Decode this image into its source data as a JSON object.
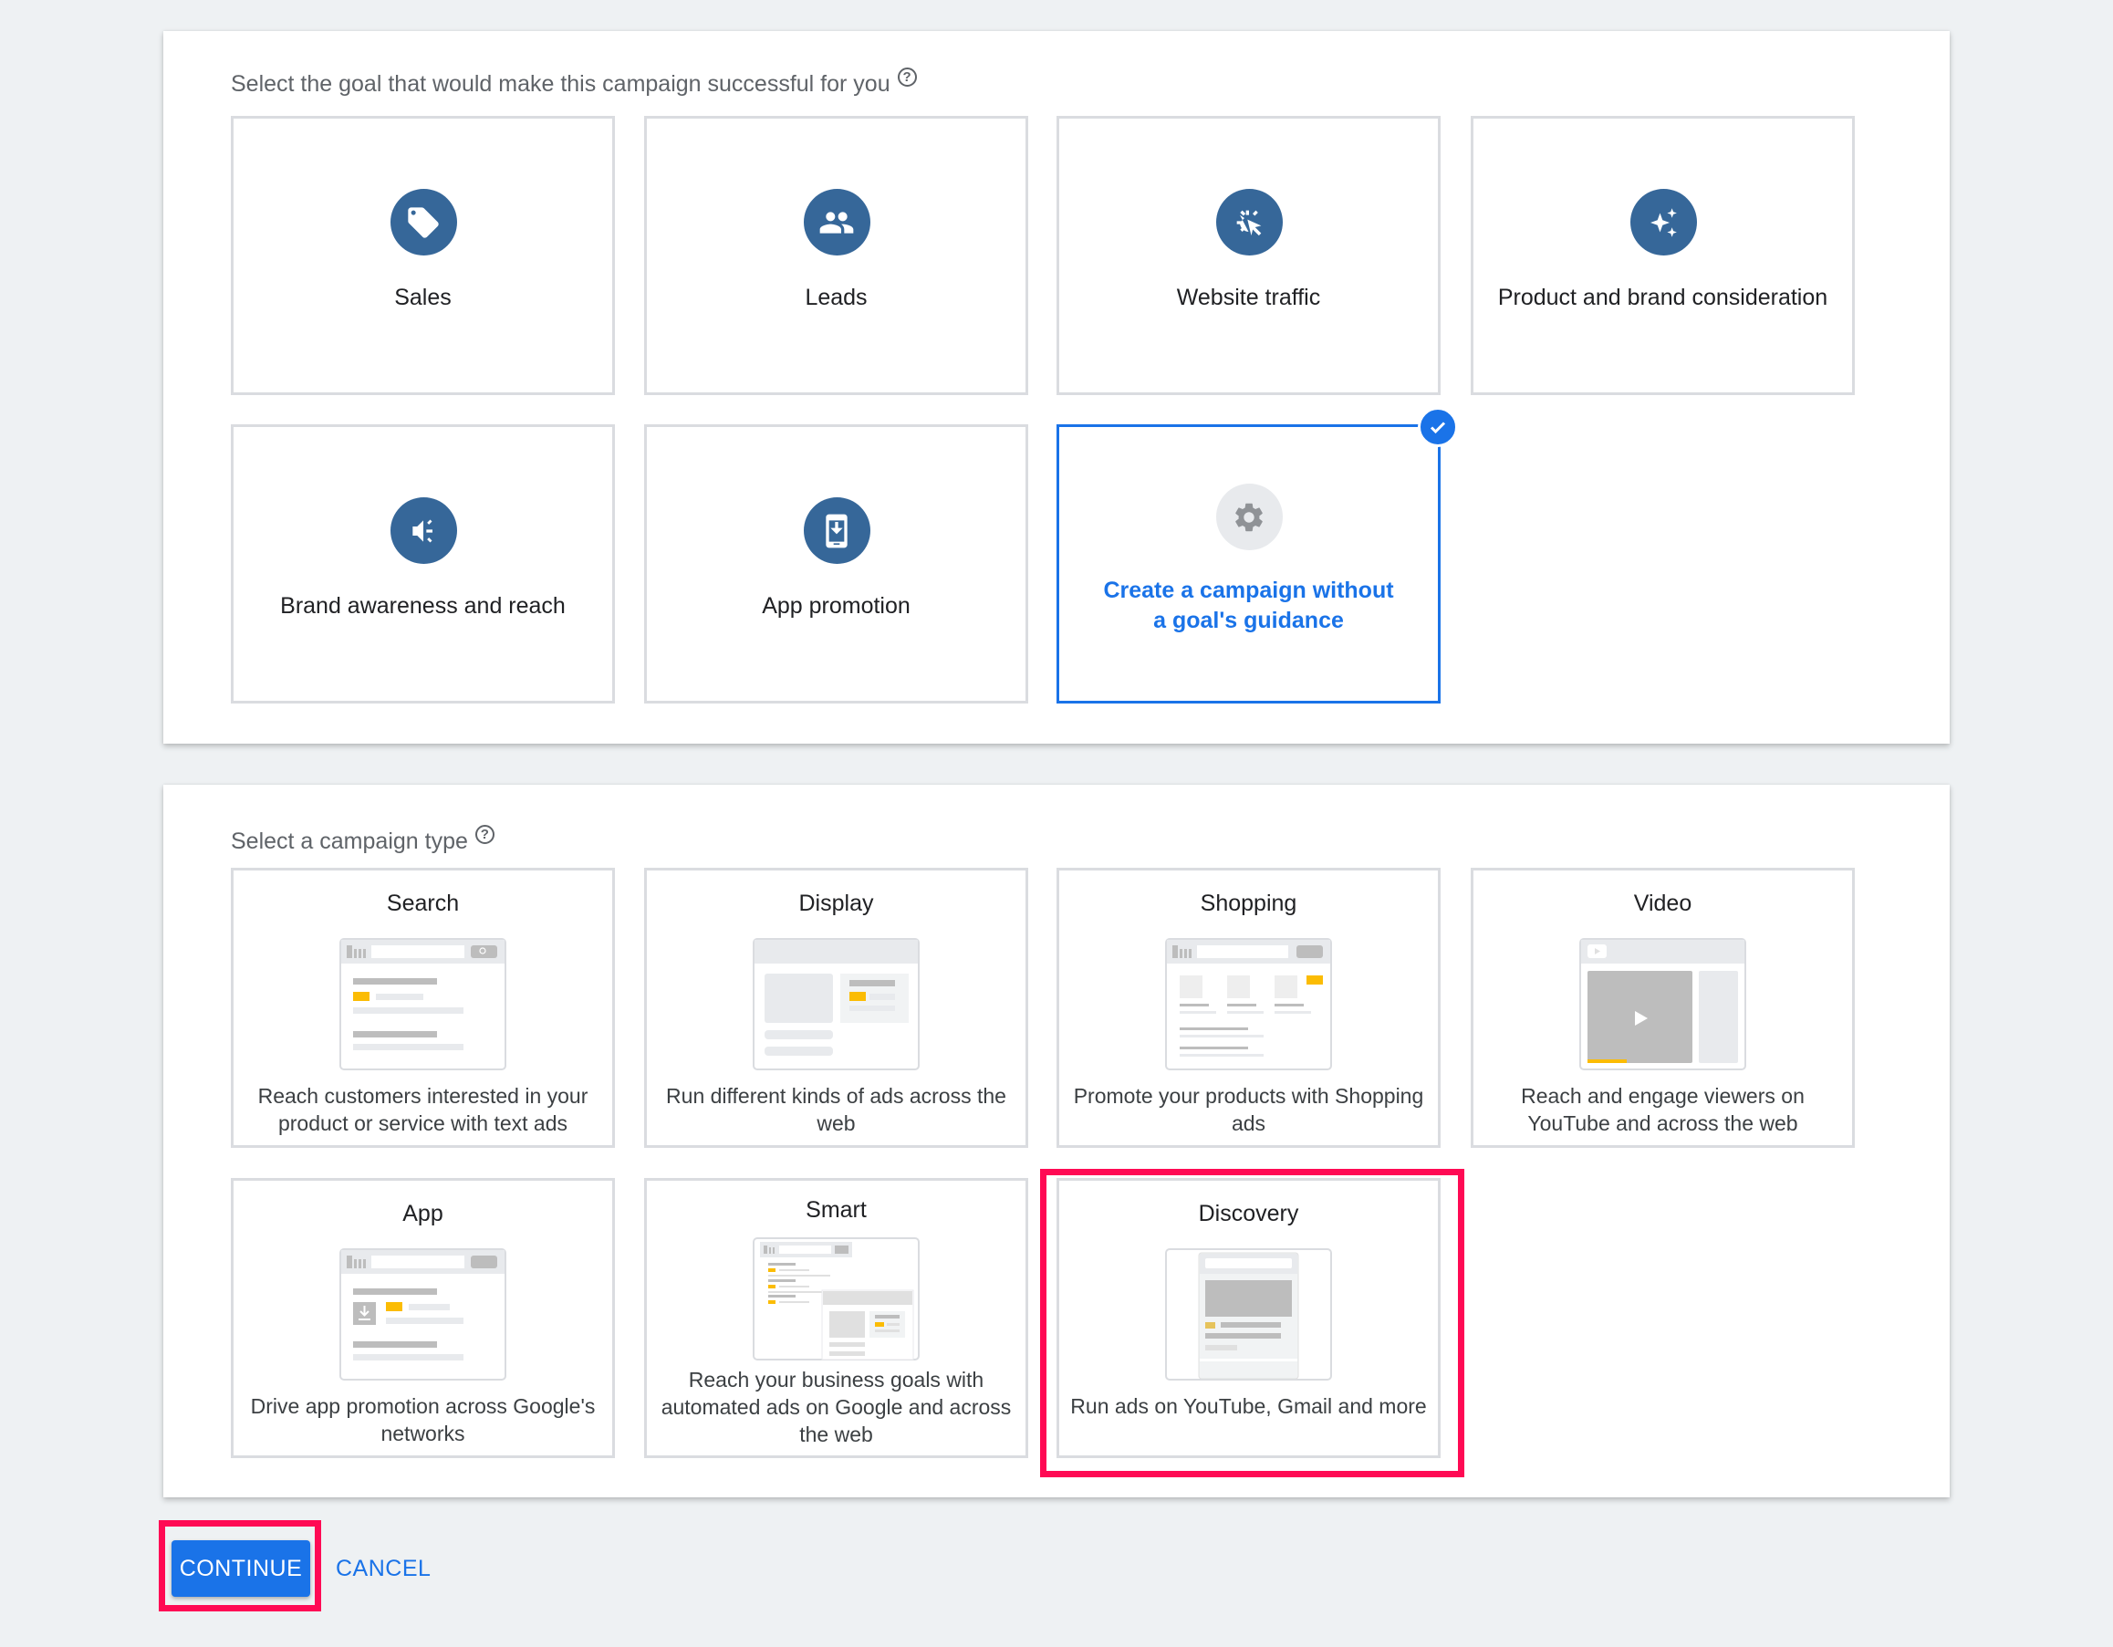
{
  "goal_section": {
    "title": "Select the goal that would make this campaign successful for you",
    "help_icon": "help-circle-icon",
    "goals": [
      {
        "label": "Sales",
        "icon": "tag-icon",
        "selected": false
      },
      {
        "label": "Leads",
        "icon": "people-icon",
        "selected": false
      },
      {
        "label": "Website traffic",
        "icon": "cursor-click-icon",
        "selected": false
      },
      {
        "label": "Product and brand consideration",
        "icon": "sparkle-icon",
        "selected": false
      },
      {
        "label": "Brand awareness and reach",
        "icon": "megaphone-icon",
        "selected": false
      },
      {
        "label": "App promotion",
        "icon": "phone-download-icon",
        "selected": false
      },
      {
        "label": "Create a campaign without a goal's guidance",
        "icon": "gear-icon",
        "selected": true
      }
    ]
  },
  "type_section": {
    "title": "Select a campaign type",
    "help_icon": "help-circle-icon",
    "types": [
      {
        "title": "Search",
        "description": "Reach customers interested in your product or service with text ads"
      },
      {
        "title": "Display",
        "description": "Run different kinds of ads across the web"
      },
      {
        "title": "Shopping",
        "description": "Promote your products with Shopping ads"
      },
      {
        "title": "Video",
        "description": "Reach and engage viewers on YouTube and across the web"
      },
      {
        "title": "App",
        "description": "Drive app promotion across Google's networks"
      },
      {
        "title": "Smart",
        "description": "Reach your business goals with automated ads on Google and across the web"
      },
      {
        "title": "Discovery",
        "description": "Run ads on YouTube, Gmail and more",
        "highlighted": true
      }
    ]
  },
  "actions": {
    "continue_label": "CONTINUE",
    "cancel_label": "CANCEL",
    "continue_highlighted": true
  },
  "colors": {
    "accent": "#1a73e8",
    "icon_circle": "#366799",
    "highlight": "#ff0a54",
    "illustration_yellow": "#fbbc04"
  }
}
